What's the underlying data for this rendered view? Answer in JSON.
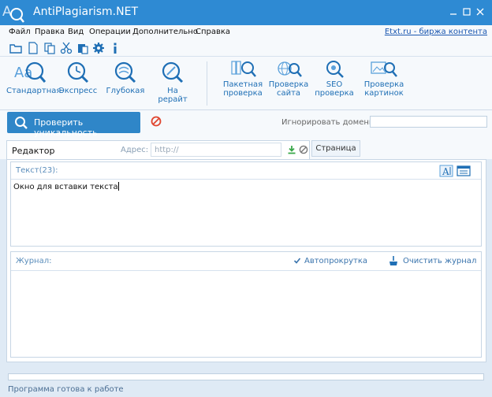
{
  "window": {
    "title": "AntiPlagiarism.NET"
  },
  "menu": {
    "items": [
      "Файл",
      "Правка",
      "Вид",
      "Операции",
      "Дополнительно",
      "Справка"
    ],
    "link": "Etxt.ru - биржа контента"
  },
  "quickbar": {
    "icons": [
      "folder-open-icon",
      "new-file-icon",
      "copy-icon",
      "cut-icon",
      "paste-icon",
      "settings-gear-icon",
      "info-icon"
    ]
  },
  "ribbon": {
    "checks": [
      {
        "label": "Стандартная",
        "icon": "standard-check-icon"
      },
      {
        "label": "Экспресс",
        "icon": "express-check-icon"
      },
      {
        "label": "Глубокая",
        "icon": "deep-check-icon"
      },
      {
        "label": "На рерайт",
        "icon": "rewrite-check-icon"
      }
    ],
    "tools": [
      {
        "label1": "Пакетная",
        "label2": "проверка",
        "icon": "batch-check-icon"
      },
      {
        "label1": "Проверка",
        "label2": "сайта",
        "icon": "site-check-icon"
      },
      {
        "label1": "SEO",
        "label2": "проверка",
        "icon": "seo-check-icon"
      },
      {
        "label1": "Проверка",
        "label2": "картинок",
        "icon": "image-check-icon"
      }
    ]
  },
  "action": {
    "check_button": "Проверить уникальность",
    "ignore_label": "Игнорировать домены:",
    "ignore_value": ""
  },
  "tabs": {
    "editor": "Редактор",
    "address_label": "Адрес:",
    "address_placeholder": "http://",
    "page": "Страница"
  },
  "text": {
    "header": "Текст(23):",
    "content": "Окно для вставки текста"
  },
  "log": {
    "header": "Журнал:",
    "autoscroll_label": "Автопрокрутка",
    "autoscroll_checked": true,
    "clear_label": "Очистить журнал"
  },
  "status": {
    "text": "Программа готова к работе",
    "progress": 0
  },
  "colors": {
    "accent": "#2e8ad3",
    "button": "#2f86c8",
    "stop": "#e0452f",
    "download": "#3aa84a"
  }
}
